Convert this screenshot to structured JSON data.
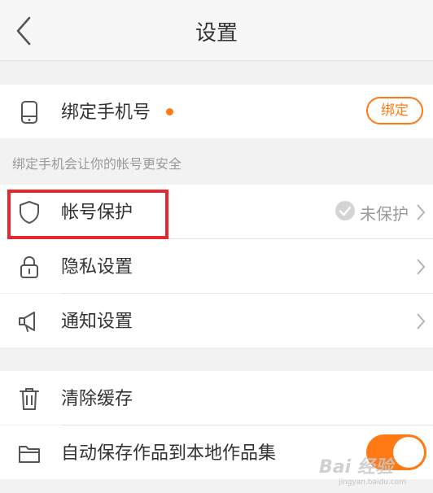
{
  "header": {
    "title": "设置"
  },
  "phone": {
    "label": "绑定手机号",
    "button": "绑定",
    "hint": "绑定手机会让你的帐号更安全"
  },
  "rows": [
    {
      "label": "帐号保护",
      "status": "未保护"
    },
    {
      "label": "隐私设置"
    },
    {
      "label": "通知设置"
    },
    {
      "label": "清除缓存"
    },
    {
      "label": "自动保存作品到本地作品集"
    }
  ],
  "toggle": {
    "on": true
  },
  "watermark": {
    "text": "Bai 经验",
    "sub": "jingyan.baidu.com"
  },
  "colors": {
    "accent": "#ff7a14",
    "highlight": "#e8262d"
  }
}
